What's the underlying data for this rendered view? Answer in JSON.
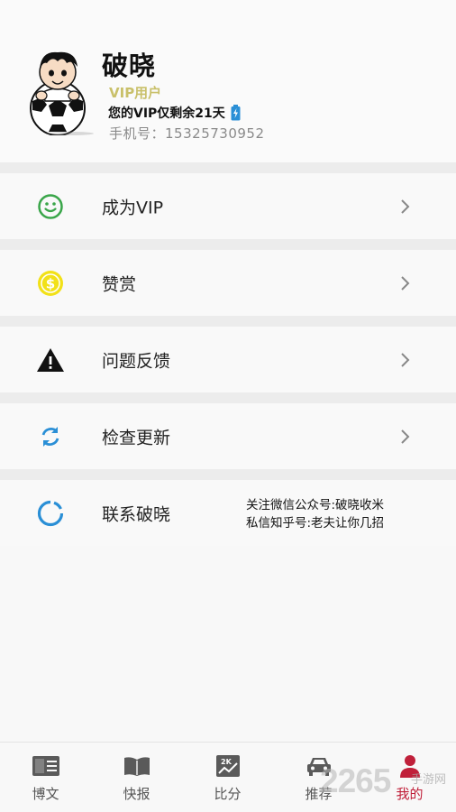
{
  "profile": {
    "name": "破晓",
    "vip_badge": "VIP用户",
    "vip_remaining": "您的VIP仅剩余21天",
    "phone_label": "手机号：",
    "phone_number": "15325730952"
  },
  "menu": [
    {
      "label": "成为VIP",
      "icon": "smiley-icon",
      "color": "#3aa64a"
    },
    {
      "label": "赞赏",
      "icon": "dollar-coin-icon",
      "color": "#f2e118"
    },
    {
      "label": "问题反馈",
      "icon": "warning-icon",
      "color": "#111111"
    },
    {
      "label": "检查更新",
      "icon": "refresh-icon",
      "color": "#2a8fd6"
    },
    {
      "label": "联系破晓",
      "icon": "ring-icon",
      "color": "#2a8fd6"
    }
  ],
  "contact": {
    "line1": "关注微信公众号:破晓收米",
    "line2": "私信知乎号:老夫让你几招"
  },
  "tabs": [
    {
      "label": "博文",
      "icon": "article-icon"
    },
    {
      "label": "快报",
      "icon": "book-icon"
    },
    {
      "label": "比分",
      "icon": "scoreboard-icon"
    },
    {
      "label": "推荐",
      "icon": "car-icon"
    },
    {
      "label": "我的",
      "icon": "user-icon",
      "active": true
    }
  ],
  "watermark": {
    "brand": "2265",
    "sub": "手游网"
  },
  "colors": {
    "accent": "#c0203a",
    "vip_gold": "#c9c06a",
    "battery": "#2a8fd6"
  }
}
